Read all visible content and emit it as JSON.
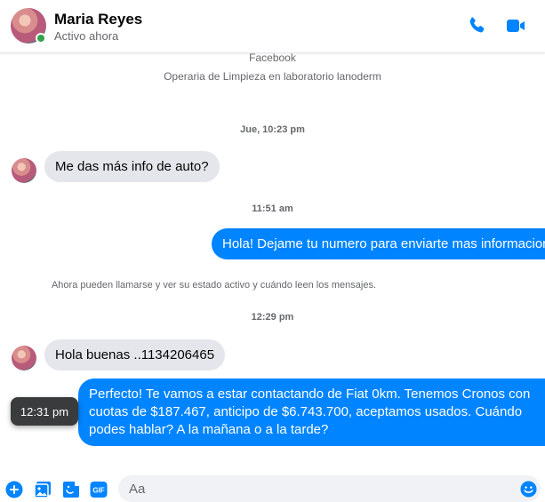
{
  "header": {
    "contact_name": "Maria Reyes",
    "status": "Activo ahora"
  },
  "intro": {
    "source": "Facebook",
    "job": "Operaria de Limpieza en laboratorio lanoderm"
  },
  "messages": {
    "ts1": "Jue, 10:23 pm",
    "m1": "Me das más info de auto?",
    "ts2": "11:51 am",
    "m2": "Hola! Dejame tu numero para enviarte mas informacion",
    "notice": "Ahora pueden llamarse y ver su estado activo y cuándo leen los mensajes.",
    "ts3": "12:29 pm",
    "m3": "Hola buenas ..1134206465",
    "m4": "Perfecto! Te vamos a estar contactando de Fiat 0km. Tenemos Cronos con cuotas de $187.467, anticipo de $6.743.700, aceptamos usados. Cuándo podes hablar? A la mañana o a la tarde?",
    "tooltip_time": "12:31 pm"
  },
  "composer": {
    "placeholder": "Aa",
    "icons": [
      "plus-icon",
      "image-icon",
      "sticker-icon",
      "gif-icon",
      "emoji-icon"
    ],
    "gif_label": "GIF"
  },
  "colors": {
    "accent": "#0084ff",
    "incoming_bubble": "#e4e6eb",
    "online": "#31a24c"
  }
}
